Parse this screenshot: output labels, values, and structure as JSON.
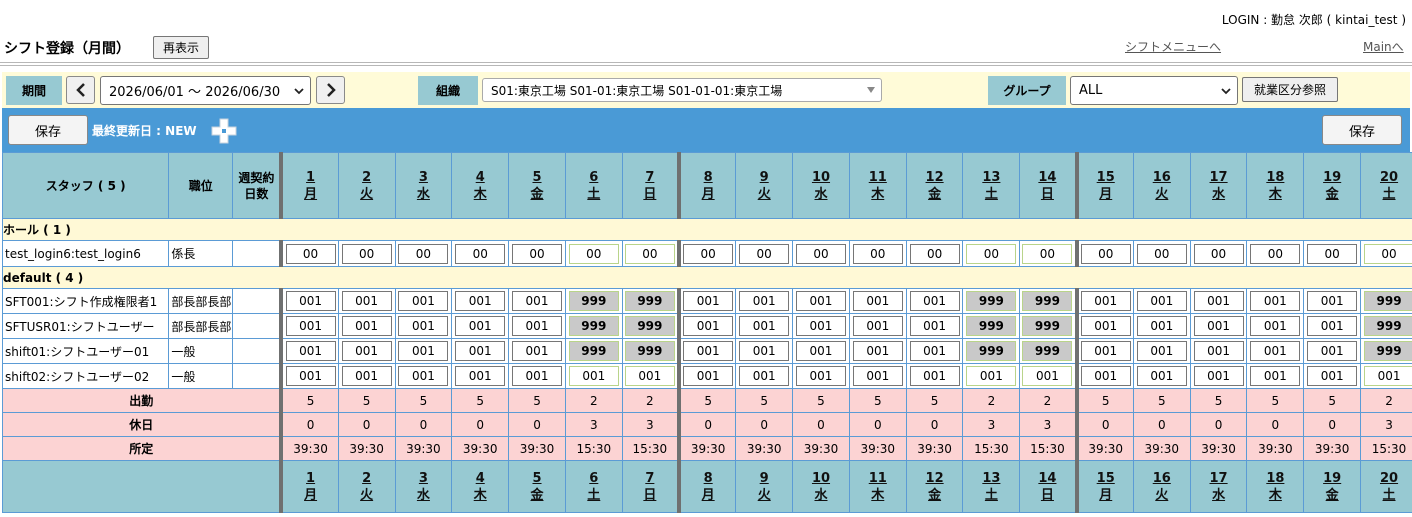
{
  "header": {
    "login": "LOGIN : 勤怠 次郎 ( kintai_test )",
    "title": "シフト登録（月間）",
    "reload_button": "再表示",
    "shift_menu_link": "シフトメニューへ",
    "main_link": "Mainへ"
  },
  "filters": {
    "period_label": "期間",
    "period_value": "2026/06/01 ～ 2026/06/30",
    "org_label": "組織",
    "org_value": "S01:東京工場 S01-01:東京工場 S01-01-01:東京工場",
    "group_label": "グループ",
    "group_value": "ALL",
    "work_type_button": "就業区分参照"
  },
  "toolbar": {
    "save_label": "保存",
    "last_updated": "最終更新日 : NEW"
  },
  "table": {
    "staff_header": "スタッフ ( 5 )",
    "position_header": "職位",
    "contract_header": "週契約日数",
    "days": [
      {
        "n": "1",
        "w": "月"
      },
      {
        "n": "2",
        "w": "火"
      },
      {
        "n": "3",
        "w": "水"
      },
      {
        "n": "4",
        "w": "木"
      },
      {
        "n": "5",
        "w": "金"
      },
      {
        "n": "6",
        "w": "土"
      },
      {
        "n": "7",
        "w": "日"
      },
      {
        "n": "8",
        "w": "月"
      },
      {
        "n": "9",
        "w": "火"
      },
      {
        "n": "10",
        "w": "水"
      },
      {
        "n": "11",
        "w": "木"
      },
      {
        "n": "12",
        "w": "金"
      },
      {
        "n": "13",
        "w": "土"
      },
      {
        "n": "14",
        "w": "日"
      },
      {
        "n": "15",
        "w": "月"
      },
      {
        "n": "16",
        "w": "火"
      },
      {
        "n": "17",
        "w": "水"
      },
      {
        "n": "18",
        "w": "木"
      },
      {
        "n": "19",
        "w": "金"
      },
      {
        "n": "20",
        "w": "土"
      }
    ],
    "groups": [
      {
        "label": "ホール ( 1 )",
        "staff": [
          {
            "name": "test_login6:test_login6",
            "position": "係長",
            "cells": [
              "00",
              "00",
              "00",
              "00",
              "00",
              "00",
              "00",
              "00",
              "00",
              "00",
              "00",
              "00",
              "00",
              "00",
              "00",
              "00",
              "00",
              "00",
              "00",
              "00"
            ]
          }
        ]
      },
      {
        "label": "default ( 4 )",
        "staff": [
          {
            "name": "SFT001:シフト作成権限者1",
            "position": "部長部長部長",
            "cells": [
              "001",
              "001",
              "001",
              "001",
              "001",
              "999",
              "999",
              "001",
              "001",
              "001",
              "001",
              "001",
              "999",
              "999",
              "001",
              "001",
              "001",
              "001",
              "001",
              "999"
            ]
          },
          {
            "name": "SFTUSR01:シフトユーザー",
            "position": "部長部長部長",
            "cells": [
              "001",
              "001",
              "001",
              "001",
              "001",
              "999",
              "999",
              "001",
              "001",
              "001",
              "001",
              "001",
              "999",
              "999",
              "001",
              "001",
              "001",
              "001",
              "001",
              "999"
            ]
          },
          {
            "name": "shift01:シフトユーザー01",
            "position": "一般",
            "cells": [
              "001",
              "001",
              "001",
              "001",
              "001",
              "999",
              "999",
              "001",
              "001",
              "001",
              "001",
              "001",
              "999",
              "999",
              "001",
              "001",
              "001",
              "001",
              "001",
              "999"
            ]
          },
          {
            "name": "shift02:シフトユーザー02",
            "position": "一般",
            "cells": [
              "001",
              "001",
              "001",
              "001",
              "001",
              "001",
              "001",
              "001",
              "001",
              "001",
              "001",
              "001",
              "001",
              "001",
              "001",
              "001",
              "001",
              "001",
              "001",
              "001"
            ]
          }
        ]
      }
    ],
    "summary": [
      {
        "label": "出勤",
        "values": [
          "5",
          "5",
          "5",
          "5",
          "5",
          "2",
          "2",
          "5",
          "5",
          "5",
          "5",
          "5",
          "2",
          "2",
          "5",
          "5",
          "5",
          "5",
          "5",
          "2"
        ]
      },
      {
        "label": "休日",
        "values": [
          "0",
          "0",
          "0",
          "0",
          "0",
          "3",
          "3",
          "0",
          "0",
          "0",
          "0",
          "0",
          "3",
          "3",
          "0",
          "0",
          "0",
          "0",
          "0",
          "3"
        ]
      },
      {
        "label": "所定",
        "values": [
          "39:30",
          "39:30",
          "39:30",
          "39:30",
          "39:30",
          "15:30",
          "15:30",
          "39:30",
          "39:30",
          "39:30",
          "39:30",
          "39:30",
          "15:30",
          "15:30",
          "39:30",
          "39:30",
          "39:30",
          "39:30",
          "39:30",
          "15:30"
        ]
      }
    ]
  },
  "icons": {
    "prev": "chevron-left-icon",
    "next": "chevron-right-icon",
    "add": "plus-icon"
  },
  "colors": {
    "header_bg": "#97c9d2",
    "toolbar_bg": "#4a9ad6",
    "filter_bg": "#fffbd8",
    "summary_bg": "#fcd3d3",
    "holiday_cell_bg": "#c9c9c9"
  }
}
